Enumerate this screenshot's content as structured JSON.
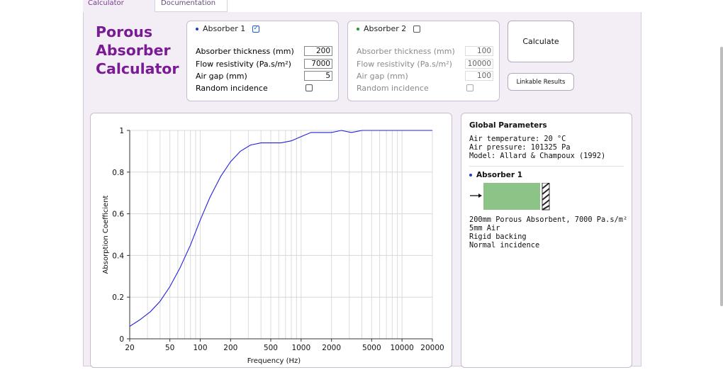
{
  "tabs": {
    "calculator": "Calculator",
    "documentation": "Documentation"
  },
  "title": "Porous\nAbsorber\nCalculator",
  "absorber1": {
    "name": "Absorber 1",
    "enabled": true,
    "dot_color": "#1a3fd0",
    "labels": [
      "Absorber thickness (mm)",
      "Flow resistivity (Pa.s/m²)",
      "Air gap (mm)",
      "Random incidence"
    ],
    "thickness": "200",
    "flow_resistivity": "7000",
    "air_gap": "5",
    "random_incidence": false
  },
  "absorber2": {
    "name": "Absorber 2",
    "enabled": false,
    "dot_color": "#1a9a2a",
    "labels": [
      "Absorber thickness (mm)",
      "Flow resistivity (Pa.s/m²)",
      "Air gap (mm)",
      "Random incidence"
    ],
    "thickness": "100",
    "flow_resistivity": "10000",
    "air_gap": "100",
    "random_incidence": false
  },
  "buttons": {
    "calculate": "Calculate",
    "linkable": "Linkable Results"
  },
  "chart_data": {
    "type": "line",
    "xlabel": "Frequency (Hz)",
    "ylabel": "Absorption Coefficient",
    "xscale": "log",
    "xlim": [
      20,
      20000
    ],
    "ylim": [
      0,
      1
    ],
    "xticks": [
      20,
      50,
      100,
      200,
      500,
      1000,
      2000,
      5000,
      10000,
      20000
    ],
    "xtick_labels": [
      "20",
      "50",
      "100",
      "200",
      "500",
      "1000",
      "2000",
      "5000",
      "10000",
      "20000"
    ],
    "yticks": [
      0,
      0.2,
      0.4,
      0.6,
      0.8,
      1
    ],
    "ytick_labels": [
      "0",
      "0.2",
      "0.4",
      "0.6",
      "0.8",
      "1"
    ],
    "grid": true,
    "series": [
      {
        "color": "#2222dd",
        "x": [
          20,
          25,
          32,
          40,
          50,
          63,
          80,
          100,
          125,
          160,
          200,
          250,
          315,
          400,
          500,
          630,
          800,
          1000,
          1250,
          1600,
          2000,
          2500,
          3150,
          4000,
          5000,
          6300,
          8000,
          10000,
          12500,
          16000,
          20000
        ],
        "y": [
          0.06,
          0.09,
          0.13,
          0.18,
          0.25,
          0.34,
          0.45,
          0.57,
          0.68,
          0.78,
          0.85,
          0.9,
          0.93,
          0.94,
          0.94,
          0.94,
          0.95,
          0.97,
          0.99,
          0.99,
          0.99,
          1.0,
          0.99,
          1.0,
          1.0,
          1.0,
          1.0,
          1.0,
          1.0,
          1.0,
          1.0
        ]
      }
    ]
  },
  "info": {
    "global_title": "Global Parameters",
    "air_temperature": "Air temperature: 20 °C",
    "air_pressure": "Air pressure: 101325 Pa",
    "model": "Model: Allard & Champoux (1992)",
    "absorber_title": "Absorber 1",
    "desc_line1": "200mm Porous Absorbent, 7000 Pa.s/m²",
    "desc_line2": "5mm Air",
    "desc_line3": "Rigid backing",
    "desc_line4": "Normal incidence",
    "absorber_color": "#8cc488"
  }
}
